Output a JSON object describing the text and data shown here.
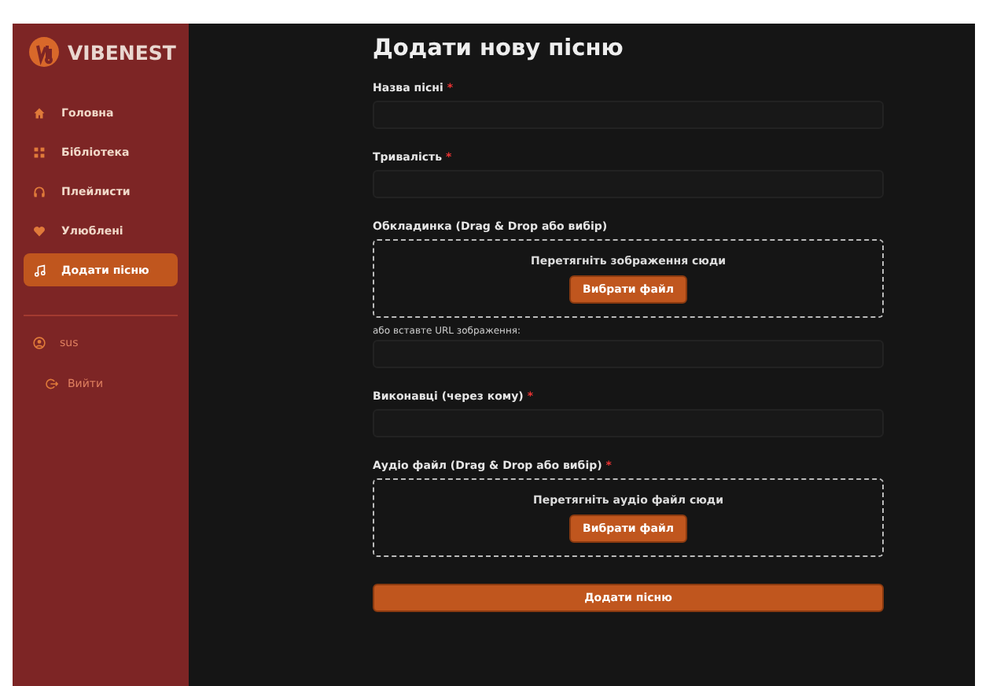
{
  "sidebar": {
    "logo": "VIBENEST",
    "items": [
      {
        "label": "Головна",
        "selected": false
      },
      {
        "label": "Бібліотека",
        "selected": false
      },
      {
        "label": "Плейлисти",
        "selected": false
      },
      {
        "label": "Улюблені",
        "selected": false
      },
      {
        "label": "Додати пісню",
        "selected": true
      }
    ],
    "user": "sus",
    "logout": "Вийти"
  },
  "form": {
    "title": "Додати нову пісню",
    "fields": [
      {
        "kind": "text",
        "label": "Назва пісні",
        "required_mark": "*"
      },
      {
        "kind": "text",
        "label": "Тривалість",
        "required_mark": "*"
      },
      {
        "kind": "dropzone",
        "label": "Обкладинка (Drag & Drop або вибір)",
        "hint": "Перетягніть зображення сюди",
        "button": "Вибрати файл"
      },
      {
        "kind": "subtext",
        "label": "або вставте URL зображення:"
      },
      {
        "kind": "text",
        "label": "Виконавці (через кому)",
        "required_mark": "*"
      },
      {
        "kind": "dropzone",
        "label": "Аудіо файл (Drag & Drop або вибір)",
        "required_mark": "*",
        "hint": "Перетягніть аудіо файл сюди",
        "button": "Вибрати файл"
      }
    ],
    "submit": "Додати пісню"
  }
}
